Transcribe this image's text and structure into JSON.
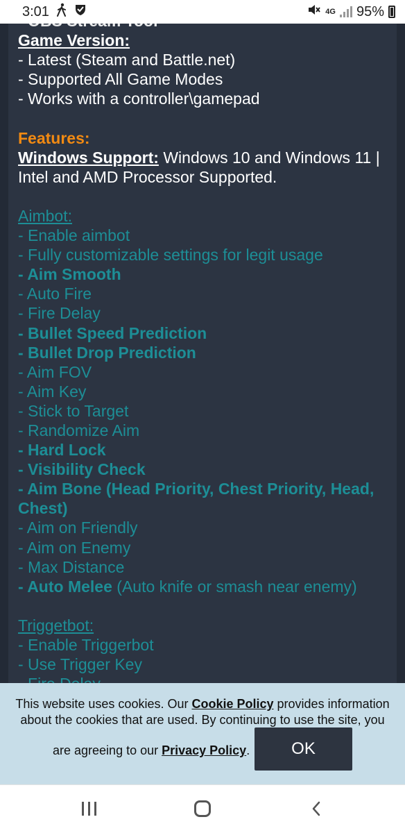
{
  "status_bar": {
    "time": "3:01",
    "battery_percent": "95%",
    "network": "4G"
  },
  "content": {
    "cut_top_text": "- OBS Stream Tool",
    "game_version_heading": "Game Version:",
    "game_version_items": [
      "- Latest (Steam and Battle.net)",
      "- Supported All Game Modes",
      "- Works with a controller\\gamepad"
    ],
    "features_heading": "Features:",
    "windows_support_label": "Windows Support:",
    "windows_support_text": " Windows 10 and Windows 11 | Intel and AMD Processor Supported.",
    "aimbot_heading": "Aimbot:",
    "aimbot_items": [
      {
        "text": "- Enable aimbot",
        "bold": false
      },
      {
        "text": "- Fully customizable settings for legit usage",
        "bold": false
      },
      {
        "text": "- Aim Smooth",
        "bold": true
      },
      {
        "text": "- Auto Fire",
        "bold": false
      },
      {
        "text": "- Fire Delay",
        "bold": false
      },
      {
        "text": "- Bullet Speed Prediction",
        "bold": true
      },
      {
        "text": "- Bullet Drop Prediction",
        "bold": true
      },
      {
        "text": "- Aim FOV",
        "bold": false
      },
      {
        "text": "- Aim Key",
        "bold": false
      },
      {
        "text": "- Stick to Target",
        "bold": false
      },
      {
        "text": "- Randomize Aim",
        "bold": false
      },
      {
        "text": "- Hard Lock",
        "bold": true
      },
      {
        "text": "- Visibility Check",
        "bold": true
      },
      {
        "text": "- Aim Bone (Head Priority, Chest Priority, Head, Chest)",
        "bold": true
      },
      {
        "text": "- Aim on Friendly",
        "bold": false
      },
      {
        "text": "- Aim on Enemy",
        "bold": false
      },
      {
        "text": "- Max Distance",
        "bold": false
      }
    ],
    "auto_melee_label": "- Auto Melee",
    "auto_melee_note": " (Auto knife or smash near enemy)",
    "triggerbot_heading": "Triggetbot:",
    "triggerbot_items": [
      "- Enable Triggerbot",
      "- Use Trigger Key",
      "- Fire Delay"
    ]
  },
  "cookie_banner": {
    "text_before": "This website uses cookies. Our ",
    "cookie_policy_link": "Cookie Policy",
    "text_middle": " provides information about the cookies that are used. By continuing to use the site, you",
    "text_line3": "are agreeing to our ",
    "privacy_policy_link": "Privacy Policy",
    "text_end": ".",
    "ok_label": "OK"
  },
  "colors": {
    "page_bg": "#232a36",
    "panel_bg": "#2c3442",
    "accent_orange": "#f28a12",
    "accent_teal": "#1d8e96",
    "cookie_bg": "#c7dde8",
    "ok_button_bg": "#2d3440"
  },
  "nav_bar": {
    "icons": [
      "recents-icon",
      "home-icon",
      "back-icon"
    ]
  }
}
